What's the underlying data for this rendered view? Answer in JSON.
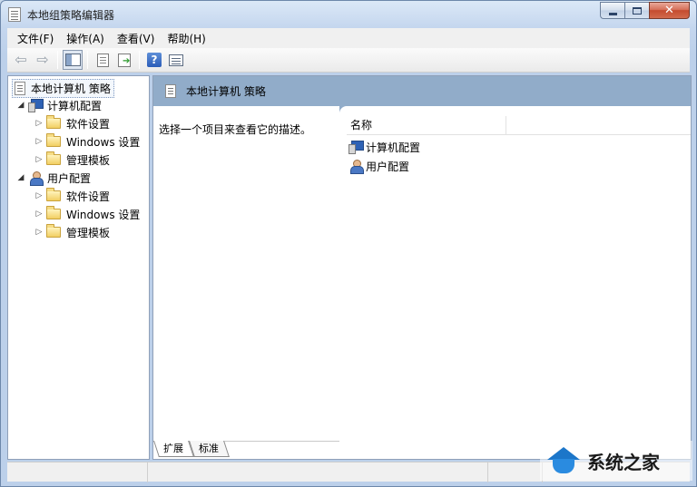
{
  "window": {
    "title": "本地组策略编辑器"
  },
  "menu": {
    "items": [
      {
        "label": "文件(F)"
      },
      {
        "label": "操作(A)"
      },
      {
        "label": "查看(V)"
      },
      {
        "label": "帮助(H)"
      }
    ]
  },
  "toolbar": {
    "back_icon": "back-arrow-icon",
    "forward_icon": "forward-arrow-icon",
    "help_glyph": "?"
  },
  "tree": {
    "root": "本地计算机 策略",
    "computer_config": "计算机配置",
    "computer_children": [
      "软件设置",
      "Windows 设置",
      "管理模板"
    ],
    "user_config": "用户配置",
    "user_children": [
      "软件设置",
      "Windows 设置",
      "管理模板"
    ]
  },
  "main": {
    "header_title": "本地计算机 策略",
    "description": "选择一个项目来查看它的描述。",
    "column_name": "名称",
    "items": [
      "计算机配置",
      "用户配置"
    ],
    "tabs": [
      "扩展",
      "标准"
    ]
  },
  "watermark": {
    "text": "系统之家"
  },
  "colors": {
    "header_band": "#91acc9",
    "close_button": "#c44b2f"
  }
}
